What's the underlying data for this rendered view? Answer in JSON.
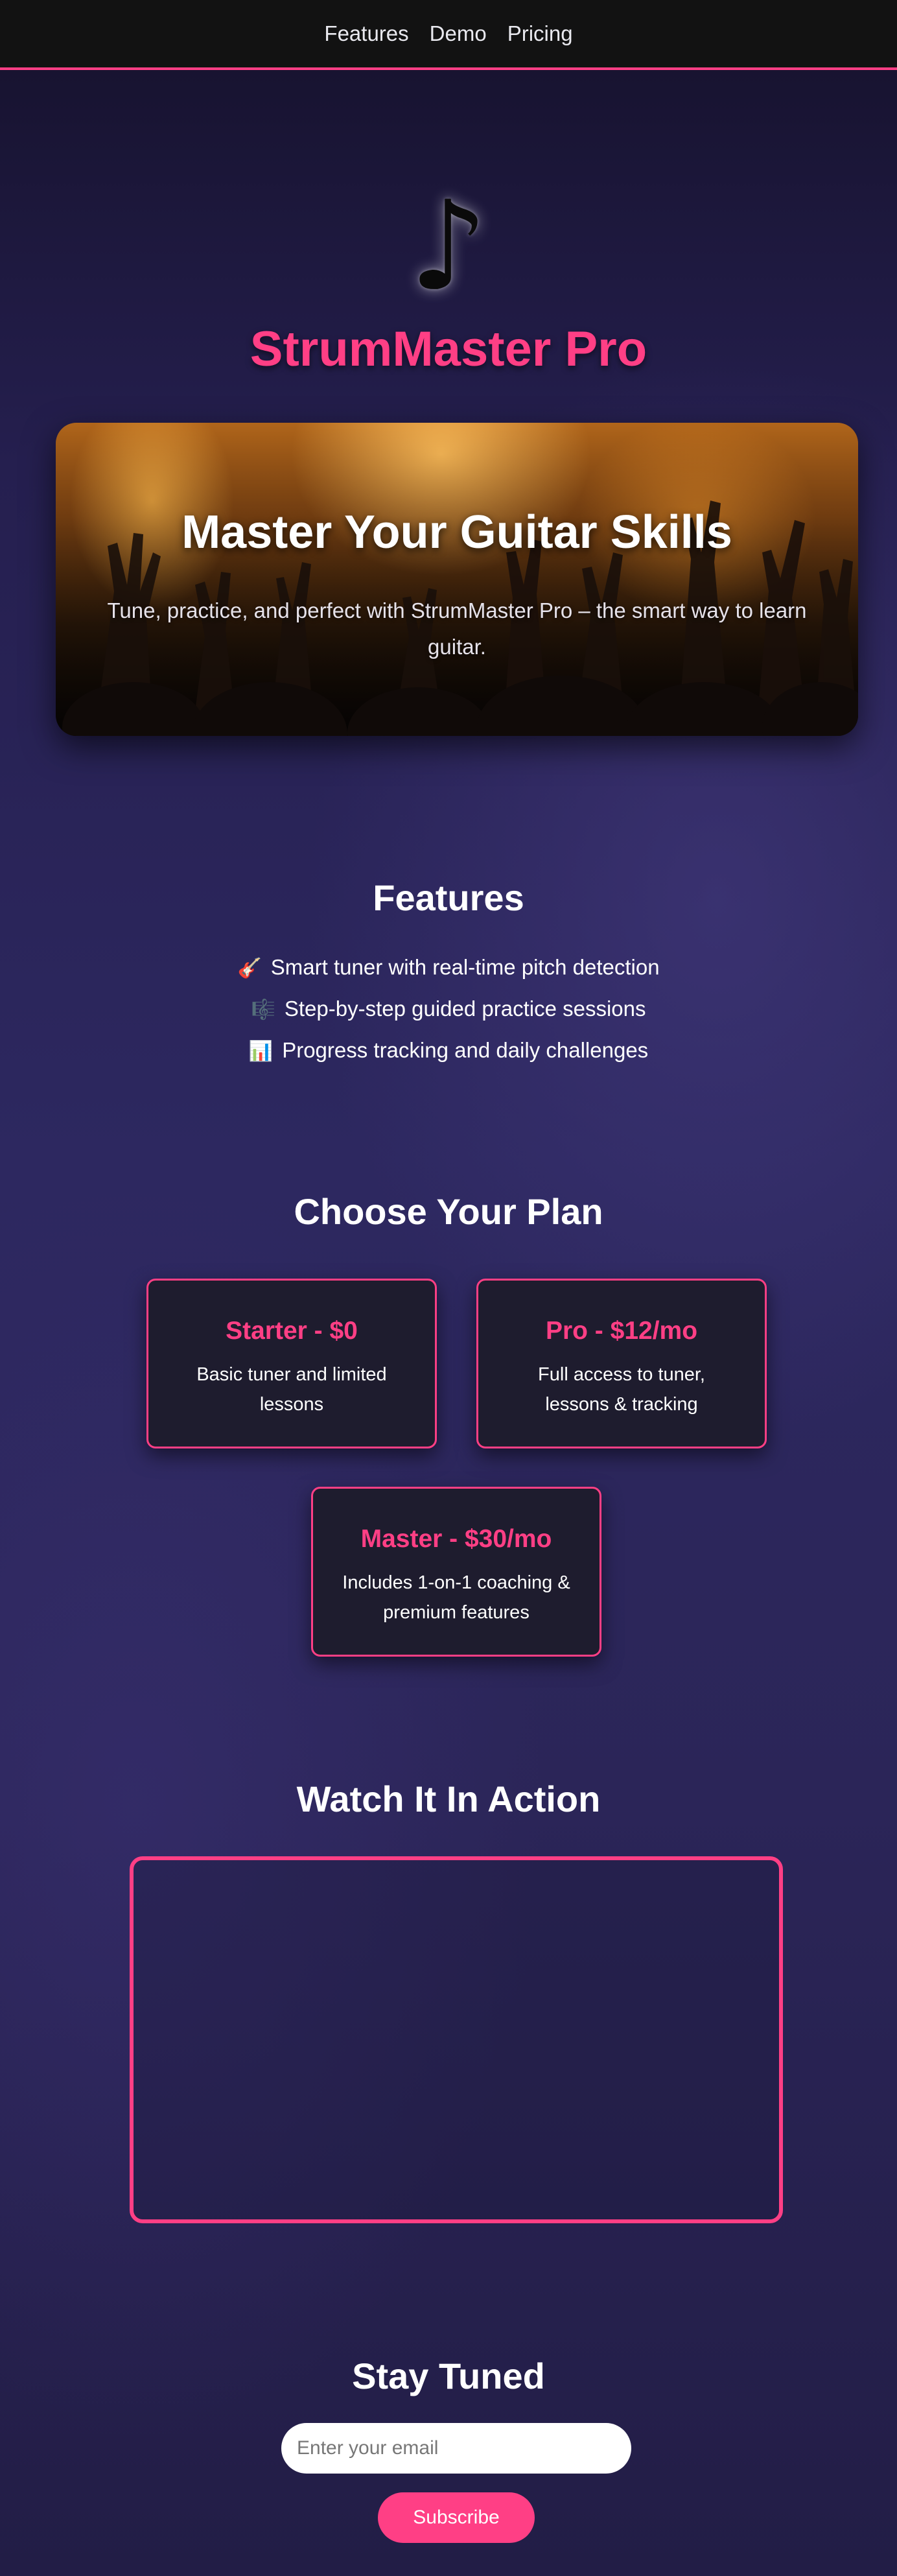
{
  "nav": {
    "items": [
      {
        "label": "Features"
      },
      {
        "label": "Demo"
      },
      {
        "label": "Pricing"
      }
    ]
  },
  "brand": {
    "logo_icon": "music-note-icon",
    "logo_glyph": "♪",
    "name": "StrumMaster Pro"
  },
  "hero": {
    "title": "Master Your Guitar Skills",
    "subtitle": "Tune, practice, and perfect with StrumMaster Pro – the smart way to learn guitar."
  },
  "features": {
    "heading": "Features",
    "items": [
      {
        "icon": "guitar-icon",
        "glyph": "🎸",
        "text": "Smart tuner with real-time pitch detection"
      },
      {
        "icon": "musical-score-icon",
        "glyph": "🎼",
        "text": "Step-by-step guided practice sessions"
      },
      {
        "icon": "bar-chart-icon",
        "glyph": "📊",
        "text": "Progress tracking and daily challenges"
      }
    ]
  },
  "pricing": {
    "heading": "Choose Your Plan",
    "plans": [
      {
        "name": "Starter - $0",
        "desc": "Basic tuner and limited lessons"
      },
      {
        "name": "Pro - $12/mo",
        "desc": "Full access to tuner, lessons & tracking"
      },
      {
        "name": "Master - $30/mo",
        "desc": "Includes 1-on-1 coaching & premium features"
      }
    ]
  },
  "demo": {
    "heading": "Watch It In Action"
  },
  "newsletter": {
    "heading": "Stay Tuned",
    "email_placeholder": "Enter your email",
    "email_value": "",
    "button_label": "Subscribe"
  },
  "colors": {
    "accent": "#ff3f85",
    "nav_bg": "#121212",
    "card_bg": "#1e1c2e",
    "page_bg": "#2d2860"
  }
}
